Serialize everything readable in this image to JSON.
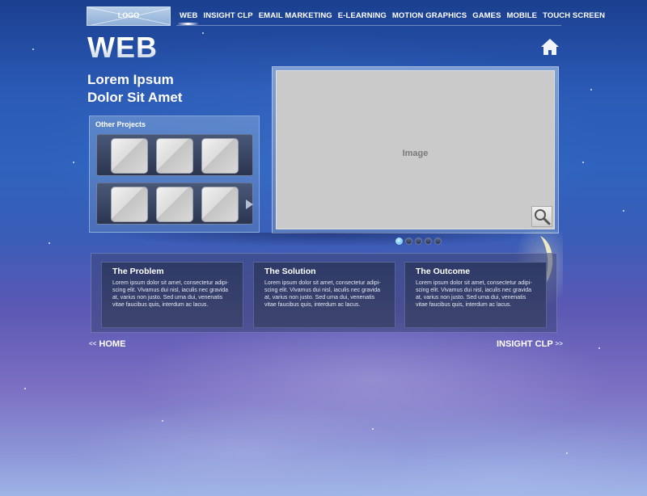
{
  "header": {
    "logo_text": "LOGO",
    "nav": [
      {
        "label": "WEB",
        "active": true
      },
      {
        "label": "INSIGHT CLP",
        "active": false
      },
      {
        "label": "EMAIL MARKETING",
        "active": false
      },
      {
        "label": "E-LEARNING",
        "active": false
      },
      {
        "label": "MOTION GRAPHICS",
        "active": false
      },
      {
        "label": "GAMES",
        "active": false
      },
      {
        "label": "MOBILE",
        "active": false
      },
      {
        "label": "TOUCH SCREEN",
        "active": false
      }
    ]
  },
  "page": {
    "title": "WEB",
    "subtitle_line1": "Lorem Ipsum",
    "subtitle_line2": "Dolor Sit Amet",
    "home_icon": "home-icon"
  },
  "projects": {
    "title": "Other Projects",
    "arrow_icon": "arrow-right-icon"
  },
  "gallery": {
    "image_label": "Image",
    "zoom_icon": "magnifier-icon",
    "slide_count": 5,
    "active_slide": 1
  },
  "info": {
    "cards": [
      {
        "title": "The Problem",
        "body": "Lorem ipsum dolor sit amet, consectetur adipi-scing elit. Vivamus dui nisl, iaculis nec gravida at, varius non justo. Sed urna dui, venenatis vitae faucibus quis, interdum ac lacus."
      },
      {
        "title": "The Solution",
        "body": "Lorem ipsum dolor sit amet, consectetur adipi-scing elit. Vivamus dui nisl, iaculis nec gravida at, varius non justo. Sed urna dui, venenatis vitae faucibus quis, interdum ac lacus."
      },
      {
        "title": "The Outcome",
        "body": "Lorem ipsum dolor sit amet, consectetur adipi-scing elit. Vivamus dui nisl, iaculis nec gravida at, varius non justo. Sed urna dui, venenatis vitae faucibus quis, interdum ac lacus."
      }
    ]
  },
  "footer_nav": {
    "back_chevron": "<<",
    "back_label": "HOME",
    "next_label": "INSIGHT CLP",
    "next_chevron": ">>"
  },
  "colors": {
    "active_dot": "#42b6ee",
    "sky_top": "#1b3f8f",
    "sky_bottom": "#9fb4e6"
  }
}
